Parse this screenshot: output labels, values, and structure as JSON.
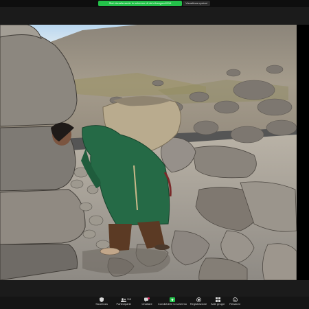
{
  "share_banner": {
    "text": "Stai visualizzando lo schermo di ntrh-thangmo2016",
    "view_options": "Visualizza opzioni"
  },
  "toolbar": {
    "items": [
      {
        "label": "Sicurezza",
        "icon": "shield-icon"
      },
      {
        "label": "Partecipanti",
        "icon": "participants-icon",
        "count": "318"
      },
      {
        "label": "Chattare",
        "icon": "chat-icon"
      },
      {
        "label": "Condividere lo schermo",
        "icon": "share-screen-icon"
      },
      {
        "label": "Registrazione",
        "icon": "record-icon"
      },
      {
        "label": "Sale gruppi",
        "icon": "breakout-rooms-icon"
      },
      {
        "label": "Reazioni",
        "icon": "reactions-icon"
      }
    ]
  },
  "colors": {
    "share_green": "#24c24a",
    "chat_badge": "#e0245e",
    "toolbar_bg": "#151515"
  }
}
